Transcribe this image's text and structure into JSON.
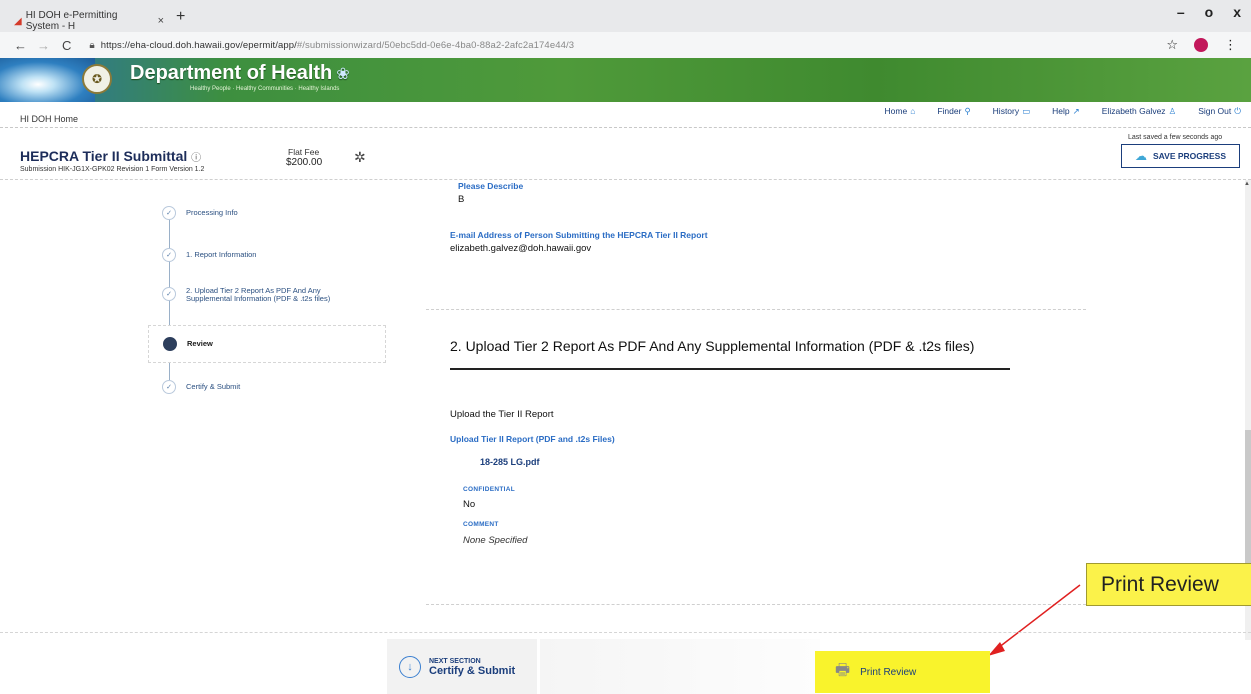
{
  "browser": {
    "tab_title": "HI DOH e-Permitting System - H",
    "tab_close": "×",
    "new_tab": "+",
    "url_main": "https://eha-cloud.doh.hawaii.gov/epermit/app/",
    "url_rest": "#/submissionwizard/50ebc5dd-0e6e-4ba0-88a2-2afc2a174e44/3",
    "win_minimize": "–",
    "win_maximize": "o",
    "win_close": "x"
  },
  "banner": {
    "department": "Department of Health",
    "tagline": "Healthy People · Healthy Communities · Healthy Islands"
  },
  "topnav": {
    "home_link": "HI DOH Home",
    "items": [
      {
        "label": "Home",
        "icon": "home-icon",
        "glyph": "⌂"
      },
      {
        "label": "Finder",
        "icon": "search-icon",
        "glyph": "⚲"
      },
      {
        "label": "History",
        "icon": "history-icon",
        "glyph": "▭"
      },
      {
        "label": "Help",
        "icon": "help-icon",
        "glyph": "↗"
      },
      {
        "label": "Elizabeth Galvez",
        "icon": "user-icon",
        "glyph": "♙"
      },
      {
        "label": "Sign Out",
        "icon": "signout-icon",
        "glyph": "⏻"
      }
    ]
  },
  "header": {
    "title": "HEPCRA Tier II Submittal",
    "info_glyph": "ⓘ",
    "subinfo": "Submission HIK-JG1X-GPK02   Revision 1   Form Version 1.2",
    "fee_label": "Flat Fee",
    "fee_value": "$200.00",
    "last_saved": "Last saved a few seconds ago",
    "save_label": "SAVE PROGRESS"
  },
  "sidebar": {
    "steps": [
      {
        "label": "Processing Info"
      },
      {
        "label": "1. Report Information"
      },
      {
        "label": "2. Upload Tier 2 Report As PDF And Any Supplemental Information (PDF & .t2s files)"
      },
      {
        "label": "Review"
      },
      {
        "label": "Certify & Submit"
      }
    ]
  },
  "main": {
    "describe_label": "Please Describe",
    "describe_value": "B",
    "email_label": "E-mail Address of Person Submitting the HEPCRA Tier II Report",
    "email_value": "elizabeth.galvez@doh.hawaii.gov",
    "section_title": "2. Upload Tier 2 Report As PDF And Any Supplemental Information (PDF & .t2s files)",
    "upload_heading": "Upload the Tier II Report",
    "upload_label": "Upload Tier II Report (PDF and .t2s Files)",
    "file_name": "18-285 LG.pdf",
    "confidential_label": "CONFIDENTIAL",
    "confidential_value": "No",
    "comment_label": "COMMENT",
    "comment_value": "None Specified"
  },
  "callout": {
    "text": "Print Review"
  },
  "bottom": {
    "next_label": "NEXT SECTION",
    "next_value": "Certify & Submit",
    "print_label": "Print Review"
  }
}
